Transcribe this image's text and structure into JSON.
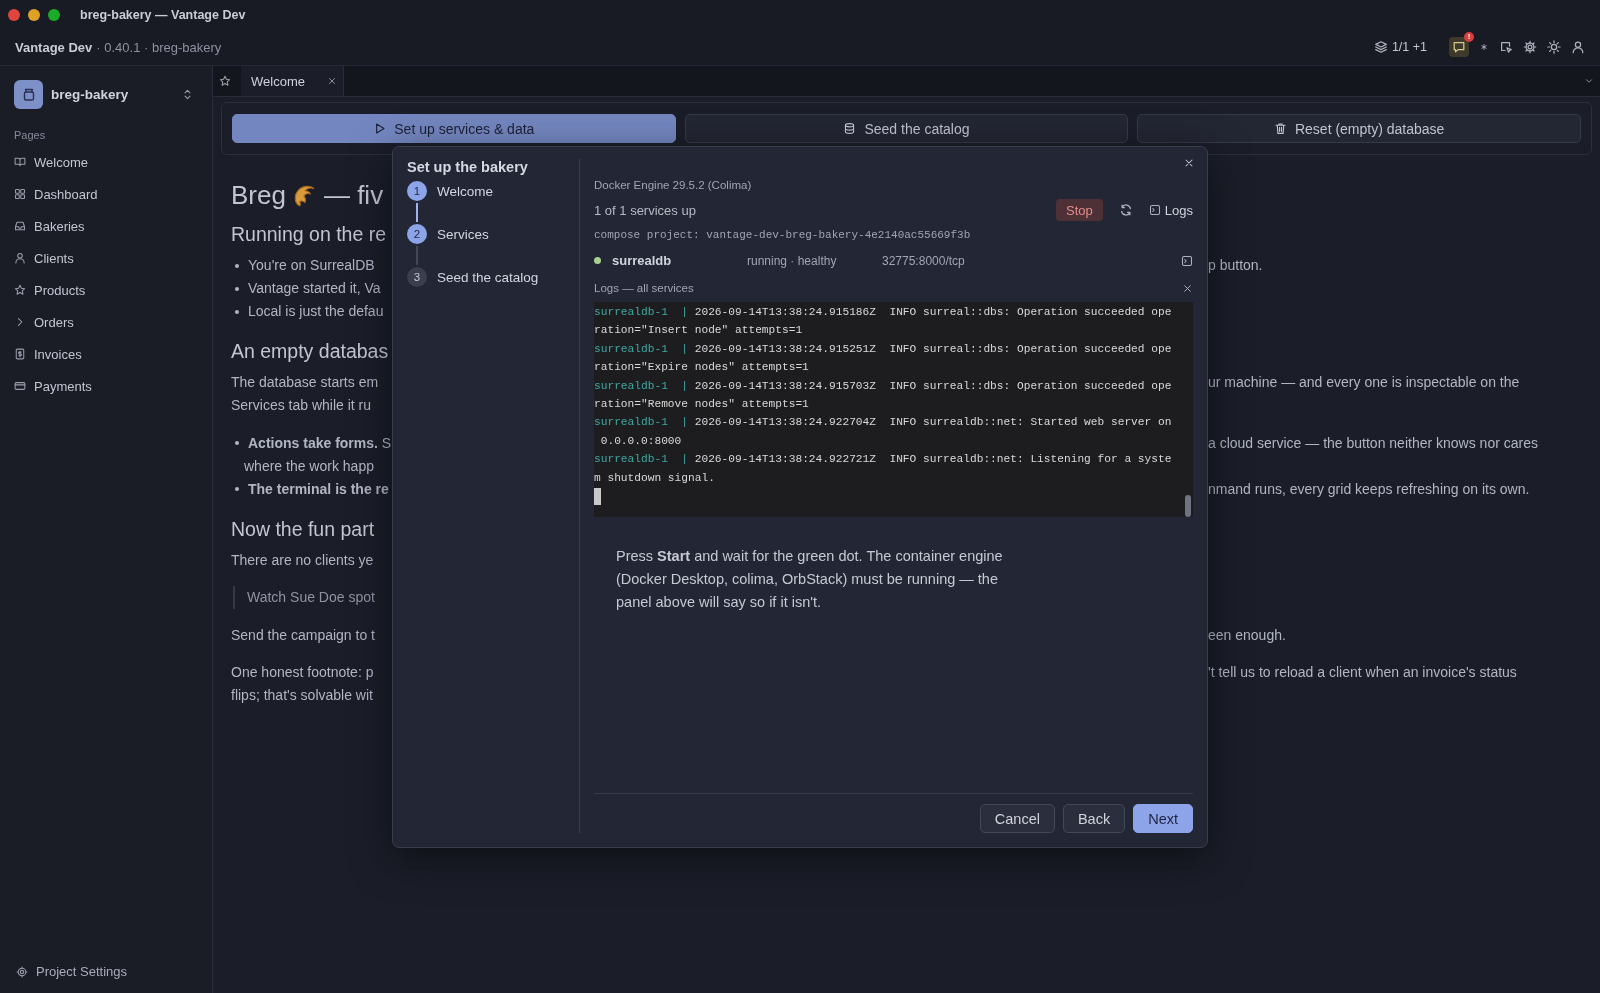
{
  "window": {
    "title": "breg-bakery — Vantage Dev"
  },
  "header": {
    "app": "Vantage Dev",
    "meta": "· 0.40.1 · breg-bakery",
    "layers": "1/1 +1",
    "badge": "!"
  },
  "sidebar": {
    "project": "breg-bakery",
    "section": "Pages",
    "items": [
      {
        "label": "Welcome",
        "kind": "page"
      },
      {
        "label": "Dashboard",
        "kind": "page"
      },
      {
        "label": "Bakeries",
        "kind": "page"
      },
      {
        "label": "Clients",
        "kind": "page"
      },
      {
        "label": "Products",
        "kind": "page"
      },
      {
        "label": "Orders",
        "kind": "group",
        "expanded": false
      },
      {
        "label": "Invoices",
        "kind": "page"
      },
      {
        "label": "Payments",
        "kind": "page"
      }
    ],
    "footer": "Project Settings"
  },
  "tabs": [
    {
      "label": "Welcome",
      "selected": true
    }
  ],
  "actions": [
    {
      "label": "Set up services & data",
      "kind": "primary"
    },
    {
      "label": "Seed the catalog",
      "kind": "secondary"
    },
    {
      "label": "Reset (empty) database",
      "kind": "secondary"
    }
  ],
  "content": {
    "blocks": [
      {
        "kind": "title",
        "left": "Breg",
        "trail": "— fiv"
      },
      {
        "kind": "heading",
        "lines": [
          {
            "left": "Running on the re"
          }
        ]
      },
      {
        "kind": "list",
        "items": [
          {
            "lines": [
              {
                "left": "You're on SurrealDB",
                "right": "p button."
              }
            ]
          },
          {
            "lines": [
              {
                "left": "Vantage started it, Va"
              }
            ]
          },
          {
            "lines": [
              {
                "left": "Local is just the defau"
              }
            ]
          }
        ]
      },
      {
        "kind": "heading",
        "lines": [
          {
            "left": "An empty databas"
          }
        ]
      },
      {
        "kind": "paragraph",
        "lines": [
          {
            "left": "The database starts em",
            "right": "ur machine — and every one is inspectable on the"
          },
          {
            "left": "Services tab while it ru"
          }
        ]
      },
      {
        "kind": "list",
        "items": [
          {
            "lines": [
              {
                "left": "**Actions take forms.** S",
                "right": "a cloud service — the button neither knows nor cares"
              },
              {
                "left": "where the work happ"
              }
            ]
          },
          {
            "lines": [
              {
                "left": "**The terminal is the re**",
                "right": "nmand runs, every grid keeps refreshing on its own."
              }
            ]
          }
        ]
      },
      {
        "kind": "heading",
        "lines": [
          {
            "left": "Now the fun part"
          }
        ]
      },
      {
        "kind": "paragraph",
        "lines": [
          {
            "left": "There are no clients ye"
          }
        ]
      },
      {
        "kind": "quote",
        "lines": [
          {
            "left": "Watch Sue Doe spot"
          }
        ]
      },
      {
        "kind": "paragraph",
        "lines": [
          {
            "left": "Send the campaign to t",
            "right": "een enough."
          }
        ]
      },
      {
        "kind": "paragraph",
        "lines": [
          {
            "left": "One honest footnote: p",
            "right": "'t tell us to reload a client when an invoice's status"
          },
          {
            "left": "flips; that's solvable wit"
          }
        ]
      }
    ]
  },
  "dialog": {
    "title": "Set up the bakery",
    "steps": [
      {
        "number": "1",
        "label": "Welcome",
        "complete": true
      },
      {
        "number": "2",
        "label": "Services",
        "complete": true
      },
      {
        "number": "3",
        "label": "Seed the catalog",
        "complete": false
      }
    ],
    "engine": "Docker Engine 29.5.2 (Colima)",
    "summary": "1 of 1 services up",
    "stop": "Stop",
    "logs_button": "Logs",
    "compose": "compose project: vantage-dev-breg-bakery-4e2140ac55669f3b",
    "services": [
      {
        "name": "surrealdb",
        "status": "running · healthy",
        "ports": "32775:8000/tcp",
        "healthy": true
      }
    ],
    "logs_title": "Logs — all services",
    "log": [
      {
        "service": "surrealdb-1  | ",
        "message": "2026-09-14T13:38:24.915186Z  INFO surreal::dbs: Operation succeeded ope",
        "wrap": "ration=\"Insert node\" attempts=1"
      },
      {
        "service": "surrealdb-1  | ",
        "message": "2026-09-14T13:38:24.915251Z  INFO surreal::dbs: Operation succeeded ope",
        "wrap": "ration=\"Expire nodes\" attempts=1"
      },
      {
        "service": "surrealdb-1  | ",
        "message": "2026-09-14T13:38:24.915703Z  INFO surreal::dbs: Operation succeeded ope",
        "wrap": "ration=\"Remove nodes\" attempts=1"
      },
      {
        "service": "surrealdb-1  | ",
        "message": "2026-09-14T13:38:24.922704Z  INFO surrealdb::net: Started web server on",
        "wrap": " 0.0.0.0:8000"
      },
      {
        "service": "surrealdb-1  | ",
        "message": "2026-09-14T13:38:24.922721Z  INFO surrealdb::net: Listening for a syste",
        "wrap": "m shutdown signal."
      }
    ],
    "help": "Press **Start** and wait for the green dot. The container engine (Docker Desktop, colima, OrbStack) must be running — the panel above will say so if it isn't.",
    "buttons": [
      {
        "label": "Cancel",
        "kind": "secondary"
      },
      {
        "label": "Back",
        "kind": "secondary"
      },
      {
        "label": "Next",
        "kind": "primary"
      }
    ]
  }
}
